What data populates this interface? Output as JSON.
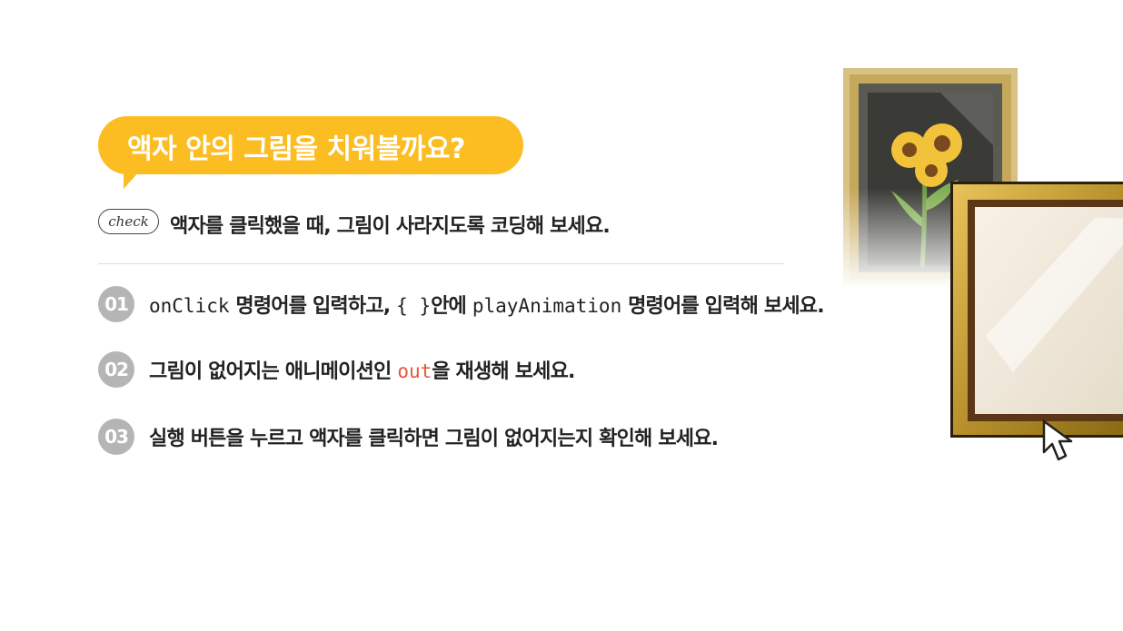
{
  "title": "액자 안의 그림을 치워볼까요?",
  "check": {
    "badge": "check",
    "text": "액자를 클릭했을 때, 그림이 사라지도록 코딩해 보세요."
  },
  "steps": [
    {
      "number": "01",
      "code1": "onClick",
      "text1": " 명령어를 입력하고, ",
      "code2": "{ }",
      "text2": "안에 ",
      "code3": "playAnimation",
      "text3": " 명령어를 입력해 보세요."
    },
    {
      "number": "02",
      "text1": "그림이 없어지는 애니메이션인 ",
      "code1": "out",
      "text2": "을 재생해 보세요."
    },
    {
      "number": "03",
      "text1": "실행 버튼을 누르고 액자를 클릭하면 그림이 없어지는지 확인해 보세요."
    }
  ],
  "colors": {
    "accent": "#fbbd22",
    "code_highlight": "#e8553b",
    "step_badge": "#b5b5b5"
  },
  "icons": {
    "sunflower_frame": "framed-sunflower-painting",
    "empty_frame": "empty-gold-frame",
    "cursor": "mouse-pointer-icon"
  }
}
